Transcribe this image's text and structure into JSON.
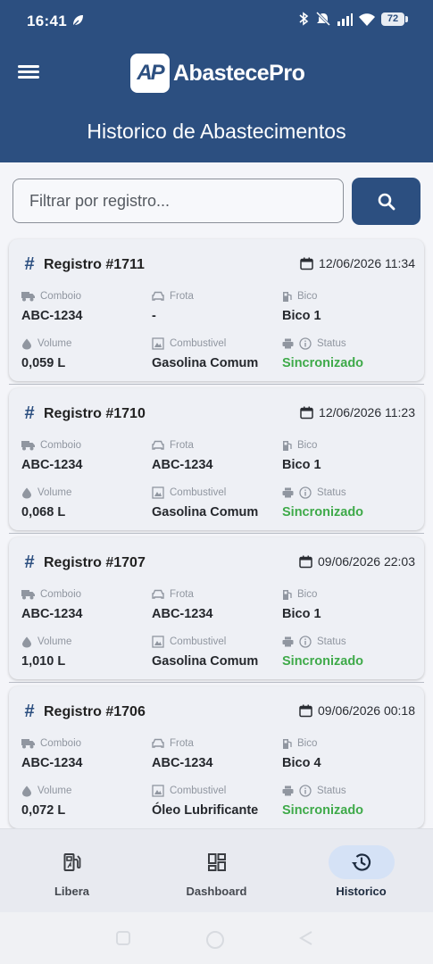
{
  "status_bar": {
    "time": "16:41",
    "battery": "72"
  },
  "header": {
    "logo_mark": "AP",
    "logo_text": "AbastecePro",
    "title": "Historico de Abastecimentos"
  },
  "search": {
    "placeholder": "Filtrar por registro..."
  },
  "field_labels": {
    "comboio": "Comboio",
    "frota": "Frota",
    "bico": "Bico",
    "volume": "Volume",
    "combustivel": "Combustivel",
    "status": "Status"
  },
  "records": [
    {
      "title": "Registro #1711",
      "datetime": "12/06/2026 11:34",
      "comboio": "ABC-1234",
      "frota": "-",
      "bico": "Bico 1",
      "volume": "0,059 L",
      "combustivel": "Gasolina Comum",
      "status": "Sincronizado"
    },
    {
      "title": "Registro #1710",
      "datetime": "12/06/2026 11:23",
      "comboio": "ABC-1234",
      "frota": "ABC-1234",
      "bico": "Bico 1",
      "volume": "0,068 L",
      "combustivel": "Gasolina Comum",
      "status": "Sincronizado"
    },
    {
      "title": "Registro #1707",
      "datetime": "09/06/2026 22:03",
      "comboio": "ABC-1234",
      "frota": "ABC-1234",
      "bico": "Bico 1",
      "volume": "1,010 L",
      "combustivel": "Gasolina Comum",
      "status": "Sincronizado"
    },
    {
      "title": "Registro #1706",
      "datetime": "09/06/2026 00:18",
      "comboio": "ABC-1234",
      "frota": "ABC-1234",
      "bico": "Bico 4",
      "volume": "0,072 L",
      "combustivel": "Óleo Lubrificante",
      "status": "Sincronizado"
    }
  ],
  "bottom_nav": [
    {
      "label": "Libera",
      "icon": "fuel-pump-icon",
      "active": false
    },
    {
      "label": "Dashboard",
      "icon": "dashboard-icon",
      "active": false
    },
    {
      "label": "Historico",
      "icon": "history-icon",
      "active": true
    }
  ],
  "colors": {
    "primary": "#2c4f80",
    "status_ok": "#3faa4a",
    "nav_active": "#d5e2f6"
  }
}
